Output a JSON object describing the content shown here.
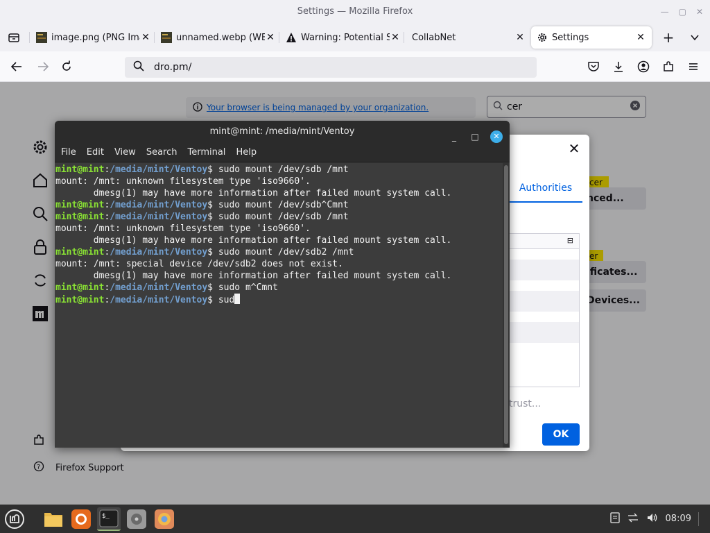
{
  "window": {
    "title": "Settings — Mozilla Firefox"
  },
  "tabs": [
    {
      "label": "image.png (PNG Ima",
      "icon": "image-icon"
    },
    {
      "label": "unnamed.webp (WE",
      "icon": "image-icon"
    },
    {
      "label": "Warning: Potential S",
      "icon": "warning-icon"
    },
    {
      "label": "CollabNet",
      "icon": ""
    },
    {
      "label": "Settings",
      "icon": "gear-icon"
    }
  ],
  "navbar": {
    "url": "dro.pm/"
  },
  "settings": {
    "policy_text": "Your browser is being managed by your organization.",
    "search_value": "cer",
    "support_label": "Firefox Support",
    "highlight_1": "cer",
    "highlight_2": "er",
    "btn_advanced": "nced...",
    "btn_certificates": "ificates...",
    "btn_devices": "Devices..."
  },
  "cert_dialog": {
    "tab_label": "Authorities",
    "trust_label": "trust...",
    "ok_label": "OK"
  },
  "terminal": {
    "title": "mint@mint: /media/mint/Ventoy",
    "menu": [
      "File",
      "Edit",
      "View",
      "Search",
      "Terminal",
      "Help"
    ],
    "prompt_user": "mint@mint",
    "prompt_path": "/media/mint/Ventoy",
    "lines": [
      {
        "type": "cmd",
        "text": " sudo mount /dev/sdb /mnt"
      },
      {
        "type": "out",
        "text": "mount: /mnt: unknown filesystem type 'iso9660'."
      },
      {
        "type": "out",
        "text": "       dmesg(1) may have more information after failed mount system call."
      },
      {
        "type": "cmd",
        "text": " sudo mount /dev/sdb^Cmnt"
      },
      {
        "type": "cmd",
        "text": " sudo mount /dev/sdb /mnt"
      },
      {
        "type": "out",
        "text": "mount: /mnt: unknown filesystem type 'iso9660'."
      },
      {
        "type": "out",
        "text": "       dmesg(1) may have more information after failed mount system call."
      },
      {
        "type": "cmd",
        "text": " sudo mount /dev/sdb2 /mnt"
      },
      {
        "type": "out",
        "text": "mount: /mnt: special device /dev/sdb2 does not exist."
      },
      {
        "type": "out",
        "text": "       dmesg(1) may have more information after failed mount system call."
      },
      {
        "type": "cmd",
        "text": " sudo m^Cmnt"
      },
      {
        "type": "cur",
        "text": " sud"
      }
    ]
  },
  "taskbar": {
    "apps": [
      "mint-menu-icon",
      "files-icon",
      "firefox-icon",
      "terminal-icon",
      "disks-icon",
      "chromium-icon"
    ],
    "clock": "08:09"
  },
  "colors": {
    "accent": "#0061e0",
    "prompt_user": "#8ae234",
    "prompt_path": "#729fcf",
    "terminal_bg": "#3c3c3c",
    "highlight": "#ffe900"
  }
}
